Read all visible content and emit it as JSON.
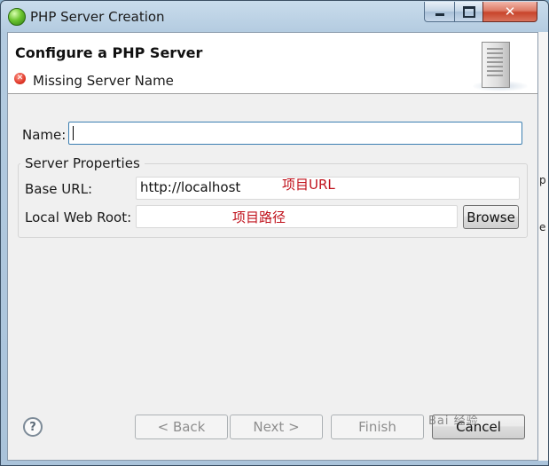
{
  "window": {
    "title": "PHP Server Creation"
  },
  "banner": {
    "title": "Configure a PHP Server",
    "message": "Missing Server Name"
  },
  "form": {
    "name_label": "Name:",
    "name_value": "",
    "group_title": "Server Properties",
    "base_url_label": "Base URL:",
    "base_url_value": "http://localhost",
    "base_url_note": "项目URL",
    "web_root_label": "Local Web Root:",
    "web_root_value": "",
    "web_root_note": "项目路径",
    "browse_label": "Browse"
  },
  "footer": {
    "help_symbol": "?",
    "back_label": "< Back",
    "next_label": "Next >",
    "finish_label": "Finish",
    "cancel_label": "Cancel"
  },
  "edge_glimpse": [
    "p",
    "e"
  ],
  "watermark": "Bai 经验",
  "colors": {
    "annotation": "#c0121c",
    "close_button": "#c8442b",
    "error_icon": "#e0392a"
  },
  "icons": [
    "app-icon",
    "error-icon",
    "server-icon",
    "help-icon",
    "minimize-icon",
    "maximize-icon",
    "close-icon"
  ]
}
